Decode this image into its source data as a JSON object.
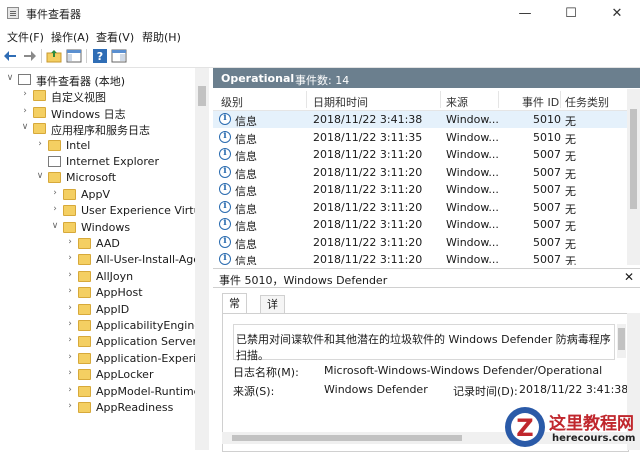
{
  "window": {
    "title": "事件查看器",
    "minimize": "—",
    "maximize": "☐",
    "close": "✕"
  },
  "menu": [
    "文件(F)",
    "操作(A)",
    "查看(V)",
    "帮助(H)"
  ],
  "tree": [
    {
      "label": "事件查看器 (本地)",
      "icon": "event-viewer-icon",
      "chev": "∨"
    },
    {
      "label": "自定义视图",
      "icon": "folder-icon",
      "chev": "›"
    },
    {
      "label": "Windows 日志",
      "icon": "folder-icon",
      "chev": "›"
    },
    {
      "label": "应用程序和服务日志",
      "icon": "folder-icon",
      "chev": "∨"
    },
    {
      "label": "Intel",
      "icon": "folder-icon",
      "chev": "›"
    },
    {
      "label": "Internet Explorer",
      "icon": "log-icon",
      "chev": ""
    },
    {
      "label": "Microsoft",
      "icon": "folder-icon",
      "chev": "∨"
    },
    {
      "label": "AppV",
      "icon": "folder-icon",
      "chev": "›"
    },
    {
      "label": "User Experience Virtualizat",
      "icon": "folder-icon",
      "chev": "›"
    },
    {
      "label": "Windows",
      "icon": "folder-icon",
      "chev": "∨"
    },
    {
      "label": "AAD",
      "icon": "folder-icon",
      "chev": "›"
    },
    {
      "label": "All-User-Install-Agent",
      "icon": "folder-icon",
      "chev": "›"
    },
    {
      "label": "AllJoyn",
      "icon": "folder-icon",
      "chev": "›"
    },
    {
      "label": "AppHost",
      "icon": "folder-icon",
      "chev": "›"
    },
    {
      "label": "AppID",
      "icon": "folder-icon",
      "chev": "›"
    },
    {
      "label": "ApplicabilityEngine",
      "icon": "folder-icon",
      "chev": "›"
    },
    {
      "label": "Application Server-App",
      "icon": "folder-icon",
      "chev": "›"
    },
    {
      "label": "Application-Experience",
      "icon": "folder-icon",
      "chev": "›"
    },
    {
      "label": "AppLocker",
      "icon": "folder-icon",
      "chev": "›"
    },
    {
      "label": "AppModel-Runtime",
      "icon": "folder-icon",
      "chev": "›"
    },
    {
      "label": "AppReadiness",
      "icon": "folder-icon",
      "chev": "›"
    }
  ],
  "log_header": {
    "name": "Operational",
    "count": "事件数: 14"
  },
  "columns": [
    "级别",
    "日期和时间",
    "来源",
    "事件 ID",
    "任务类别"
  ],
  "rows": [
    {
      "level": "信息",
      "datetime": "2018/11/22 3:41:38",
      "source": "Window...",
      "id": "5010",
      "task": "无"
    },
    {
      "level": "信息",
      "datetime": "2018/11/22 3:11:35",
      "source": "Window...",
      "id": "5010",
      "task": "无"
    },
    {
      "level": "信息",
      "datetime": "2018/11/22 3:11:20",
      "source": "Window...",
      "id": "5007",
      "task": "无"
    },
    {
      "level": "信息",
      "datetime": "2018/11/22 3:11:20",
      "source": "Window...",
      "id": "5007",
      "task": "无"
    },
    {
      "level": "信息",
      "datetime": "2018/11/22 3:11:20",
      "source": "Window...",
      "id": "5007",
      "task": "无"
    },
    {
      "level": "信息",
      "datetime": "2018/11/22 3:11:20",
      "source": "Window...",
      "id": "5007",
      "task": "无"
    },
    {
      "level": "信息",
      "datetime": "2018/11/22 3:11:20",
      "source": "Window...",
      "id": "5007",
      "task": "无"
    },
    {
      "level": "信息",
      "datetime": "2018/11/22 3:11:20",
      "source": "Window...",
      "id": "5007",
      "task": "无"
    },
    {
      "level": "信息",
      "datetime": "2018/11/22 3:11:20",
      "source": "Window...",
      "id": "5007",
      "task": "无"
    }
  ],
  "detail": {
    "title": "事件 5010，Windows Defender",
    "close": "✕",
    "tabs": [
      "常规",
      "详细信息"
    ],
    "message": "已禁用对间谍软件和其他潜在的垃圾软件的 Windows Defender 防病毒程序 扫描。",
    "log_name_label": "日志名称(M):",
    "log_name_value": "Microsoft-Windows-Windows Defender/Operational",
    "source_label": "来源(S):",
    "source_value": "Windows Defender",
    "recorded_label": "记录时间(D):",
    "recorded_value": "2018/11/22 3:41:38"
  },
  "watermark": {
    "line1": "这里教程网",
    "line2": "herecours.com"
  },
  "colors": {
    "header_strip": "#6b7f8e",
    "selected_row": "#e5f1fb",
    "info_blue": "#2b6cb0"
  }
}
